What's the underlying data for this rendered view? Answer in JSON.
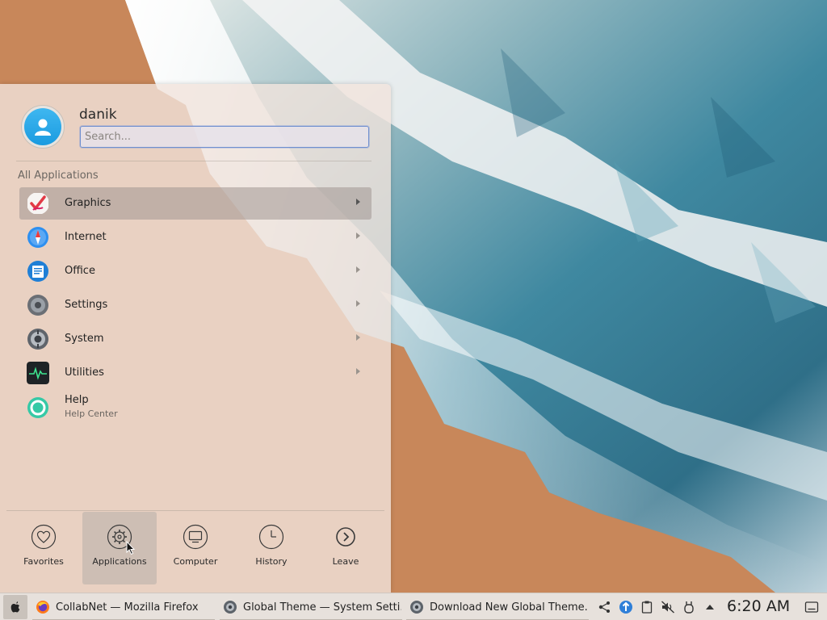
{
  "launcher": {
    "username": "danik",
    "search_placeholder": "Search...",
    "section_title": "All Applications",
    "apps": [
      {
        "label": "Graphics",
        "icon": "graphics-icon",
        "selected": true
      },
      {
        "label": "Internet",
        "icon": "internet-icon"
      },
      {
        "label": "Office",
        "icon": "office-icon"
      },
      {
        "label": "Settings",
        "icon": "settings-icon"
      },
      {
        "label": "System",
        "icon": "system-icon"
      },
      {
        "label": "Utilities",
        "icon": "utilities-icon"
      },
      {
        "label": "Help",
        "sublabel": "Help Center",
        "icon": "help-icon"
      }
    ],
    "tabs": [
      {
        "label": "Favorites",
        "icon": "heart-icon"
      },
      {
        "label": "Applications",
        "icon": "gear-icon",
        "active": true
      },
      {
        "label": "Computer",
        "icon": "computer-icon"
      },
      {
        "label": "History",
        "icon": "clock-icon"
      },
      {
        "label": "Leave",
        "icon": "leave-arrow-icon"
      }
    ]
  },
  "taskbar": {
    "tasks": [
      {
        "label": "CollabNet — Mozilla Firefox",
        "icon": "firefox-icon"
      },
      {
        "label": "Global Theme  — System Setti...",
        "icon": "system-settings-icon"
      },
      {
        "label": "Download New Global Theme...",
        "icon": "system-settings-icon"
      }
    ],
    "tray_icons": [
      "kde-connect-icon",
      "update-notifier-icon",
      "clipboard-icon",
      "volume-muted-icon",
      "device-notifier-icon",
      "expand-tray-icon"
    ],
    "clock": "6:20 AM"
  },
  "colors": {
    "sand": "#c8875a",
    "sea": "#4e8fa6",
    "panel": "#f1e4dc",
    "accent": "#6f8fcf"
  }
}
